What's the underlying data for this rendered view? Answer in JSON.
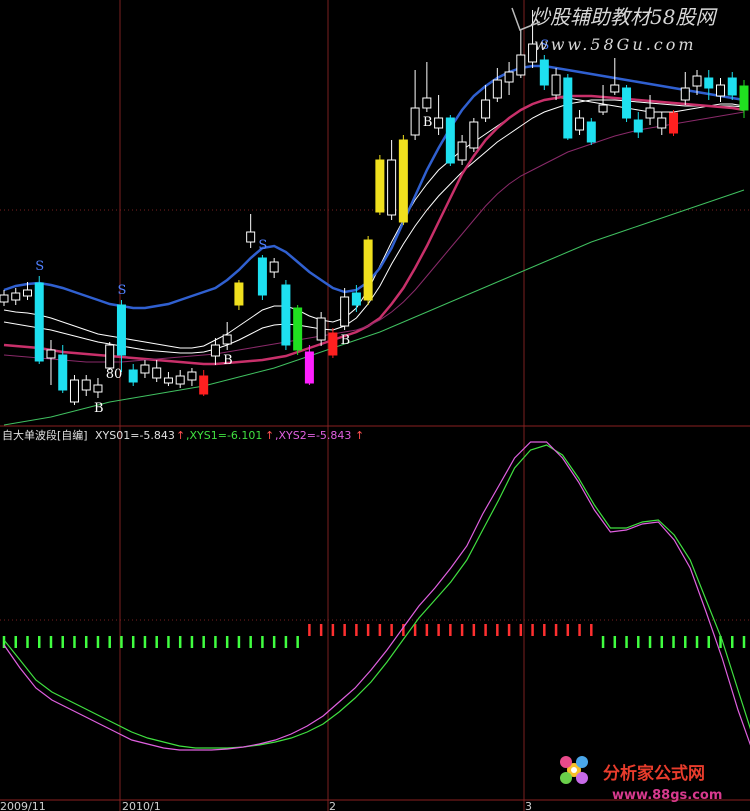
{
  "watermark_top": {
    "line1": "炒股辅助教材58股网",
    "line2": "www.58Gu.com"
  },
  "indicator_header": {
    "name": "自大单波段[自编]",
    "xys01": "XYS01=-5.843",
    "xys1": ",XYS1=-6.101",
    "xys2": ",XYS2=-5.843",
    "arrow": "↑"
  },
  "watermark_bottom": {
    "line1": "分析家公式网",
    "line2": "www.88gs.com"
  },
  "colors": {
    "background": "#000000",
    "grid": "#7a1f1f",
    "candle_cyan": "#1ee0f0",
    "candle_yellow": "#f0e01e",
    "candle_red": "#ff2020",
    "candle_green": "#20e020",
    "candle_magenta": "#ff20ff",
    "signal_red": "#ff3030",
    "signal_green": "#40ff40",
    "xys1_line": "#40e040",
    "xys2_line": "#e060e0"
  },
  "chart_data": [
    {
      "type": "candlestick",
      "title": "",
      "x_ticks": [
        "2009/11",
        "2010/1",
        "2",
        "3"
      ],
      "annotations": [
        {
          "text": "S",
          "bar": 3
        },
        {
          "text": "S",
          "bar": 10
        },
        {
          "text": "S",
          "bar": 22
        },
        {
          "text": "S",
          "bar": 46
        },
        {
          "text": "B",
          "bar": 8
        },
        {
          "text": "B",
          "bar": 19
        },
        {
          "text": "B",
          "bar": 29
        },
        {
          "text": "B",
          "bar": 36
        },
        {
          "text": "80",
          "bar": 9
        }
      ],
      "candles": [
        {
          "o": 295,
          "c": 302,
          "h": 290,
          "l": 306,
          "color": "white"
        },
        {
          "o": 300,
          "c": 293,
          "h": 288,
          "l": 305,
          "color": "white"
        },
        {
          "o": 290,
          "c": 296,
          "h": 282,
          "l": 300,
          "color": "white"
        },
        {
          "o": 283,
          "c": 361,
          "h": 276,
          "l": 364,
          "color": "cyan"
        },
        {
          "o": 350,
          "c": 358,
          "h": 340,
          "l": 385,
          "color": "white"
        },
        {
          "o": 355,
          "c": 390,
          "h": 345,
          "l": 393,
          "color": "cyan"
        },
        {
          "o": 380,
          "c": 402,
          "h": 375,
          "l": 405,
          "color": "white"
        },
        {
          "o": 390,
          "c": 380,
          "h": 375,
          "l": 396,
          "color": "white"
        },
        {
          "o": 385,
          "c": 392,
          "h": 378,
          "l": 398,
          "color": "white"
        },
        {
          "o": 345,
          "c": 368,
          "h": 342,
          "l": 370,
          "color": "white"
        },
        {
          "o": 305,
          "c": 355,
          "h": 300,
          "l": 372,
          "color": "cyan"
        },
        {
          "o": 370,
          "c": 382,
          "h": 364,
          "l": 386,
          "color": "cyan"
        },
        {
          "o": 373,
          "c": 365,
          "h": 360,
          "l": 378,
          "color": "white"
        },
        {
          "o": 368,
          "c": 378,
          "h": 360,
          "l": 382,
          "color": "white"
        },
        {
          "o": 378,
          "c": 383,
          "h": 372,
          "l": 386,
          "color": "white"
        },
        {
          "o": 376,
          "c": 384,
          "h": 370,
          "l": 388,
          "color": "white"
        },
        {
          "o": 372,
          "c": 380,
          "h": 368,
          "l": 386,
          "color": "white"
        },
        {
          "o": 376,
          "c": 394,
          "h": 370,
          "l": 396,
          "color": "red"
        },
        {
          "o": 345,
          "c": 356,
          "h": 338,
          "l": 365,
          "color": "white"
        },
        {
          "o": 335,
          "c": 344,
          "h": 322,
          "l": 350,
          "color": "white"
        },
        {
          "o": 283,
          "c": 305,
          "h": 280,
          "l": 310,
          "color": "yellow"
        },
        {
          "o": 232,
          "c": 242,
          "h": 214,
          "l": 248,
          "color": "white"
        },
        {
          "o": 258,
          "c": 295,
          "h": 255,
          "l": 300,
          "color": "cyan"
        },
        {
          "o": 262,
          "c": 272,
          "h": 258,
          "l": 278,
          "color": "white"
        },
        {
          "o": 285,
          "c": 345,
          "h": 280,
          "l": 350,
          "color": "cyan"
        },
        {
          "o": 308,
          "c": 350,
          "h": 305,
          "l": 355,
          "color": "green"
        },
        {
          "o": 352,
          "c": 383,
          "h": 345,
          "l": 385,
          "color": "magenta"
        },
        {
          "o": 318,
          "c": 340,
          "h": 312,
          "l": 346,
          "color": "white"
        },
        {
          "o": 355,
          "c": 333,
          "h": 328,
          "l": 358,
          "color": "red"
        },
        {
          "o": 297,
          "c": 326,
          "h": 288,
          "l": 330,
          "color": "white"
        },
        {
          "o": 293,
          "c": 305,
          "h": 285,
          "l": 312,
          "color": "cyan"
        },
        {
          "o": 240,
          "c": 300,
          "h": 236,
          "l": 305,
          "color": "yellow"
        },
        {
          "o": 160,
          "c": 212,
          "h": 155,
          "l": 215,
          "color": "yellow"
        },
        {
          "o": 160,
          "c": 215,
          "h": 140,
          "l": 220,
          "color": "white"
        },
        {
          "o": 140,
          "c": 222,
          "h": 135,
          "l": 225,
          "color": "yellow"
        },
        {
          "o": 108,
          "c": 135,
          "h": 70,
          "l": 140,
          "color": "white"
        },
        {
          "o": 98,
          "c": 108,
          "h": 62,
          "l": 112,
          "color": "white"
        },
        {
          "o": 118,
          "c": 128,
          "h": 95,
          "l": 135,
          "color": "white"
        },
        {
          "o": 118,
          "c": 163,
          "h": 115,
          "l": 166,
          "color": "cyan"
        },
        {
          "o": 142,
          "c": 160,
          "h": 135,
          "l": 165,
          "color": "white"
        },
        {
          "o": 122,
          "c": 148,
          "h": 118,
          "l": 152,
          "color": "white"
        },
        {
          "o": 100,
          "c": 118,
          "h": 85,
          "l": 122,
          "color": "white"
        },
        {
          "o": 80,
          "c": 98,
          "h": 68,
          "l": 102,
          "color": "white"
        },
        {
          "o": 72,
          "c": 82,
          "h": 62,
          "l": 95,
          "color": "white"
        },
        {
          "o": 55,
          "c": 75,
          "h": 30,
          "l": 78,
          "color": "white"
        },
        {
          "o": 44,
          "c": 62,
          "h": 10,
          "l": 68,
          "color": "white"
        },
        {
          "o": 60,
          "c": 85,
          "h": 55,
          "l": 90,
          "color": "cyan"
        },
        {
          "o": 75,
          "c": 95,
          "h": 68,
          "l": 100,
          "color": "white"
        },
        {
          "o": 78,
          "c": 138,
          "h": 74,
          "l": 140,
          "color": "cyan"
        },
        {
          "o": 118,
          "c": 130,
          "h": 110,
          "l": 135,
          "color": "white"
        },
        {
          "o": 122,
          "c": 142,
          "h": 118,
          "l": 145,
          "color": "cyan"
        },
        {
          "o": 105,
          "c": 112,
          "h": 85,
          "l": 115,
          "color": "white"
        },
        {
          "o": 85,
          "c": 92,
          "h": 58,
          "l": 95,
          "color": "white"
        },
        {
          "o": 88,
          "c": 118,
          "h": 85,
          "l": 122,
          "color": "cyan"
        },
        {
          "o": 120,
          "c": 132,
          "h": 112,
          "l": 138,
          "color": "cyan"
        },
        {
          "o": 108,
          "c": 118,
          "h": 95,
          "l": 125,
          "color": "white"
        },
        {
          "o": 118,
          "c": 128,
          "h": 112,
          "l": 135,
          "color": "white"
        },
        {
          "o": 113,
          "c": 133,
          "h": 110,
          "l": 136,
          "color": "red"
        },
        {
          "o": 88,
          "c": 100,
          "h": 72,
          "l": 105,
          "color": "white"
        },
        {
          "o": 76,
          "c": 86,
          "h": 70,
          "l": 95,
          "color": "white"
        },
        {
          "o": 78,
          "c": 88,
          "h": 70,
          "l": 100,
          "color": "cyan"
        },
        {
          "o": 85,
          "c": 96,
          "h": 78,
          "l": 102,
          "color": "white"
        },
        {
          "o": 78,
          "c": 95,
          "h": 72,
          "l": 100,
          "color": "cyan"
        },
        {
          "o": 86,
          "c": 110,
          "h": 80,
          "l": 118,
          "color": "green"
        }
      ],
      "moving_averages": [
        {
          "color": "#ffffff",
          "y": [
            310,
            312,
            313,
            315,
            318,
            322,
            326,
            330,
            334,
            336,
            338,
            340,
            342,
            344,
            346,
            348,
            348,
            346,
            340,
            334,
            326,
            318,
            310,
            306,
            306,
            310,
            316,
            320,
            322,
            318,
            308,
            290,
            266,
            242,
            220,
            200,
            184,
            170,
            160,
            150,
            142,
            134,
            126,
            118,
            110,
            104,
            100,
            98,
            98,
            100,
            102,
            104,
            106,
            108,
            110,
            112,
            112,
            112,
            110,
            108,
            106,
            104,
            104,
            106
          ]
        },
        {
          "color": "#ffffff",
          "y": [
            322,
            324,
            326,
            328,
            330,
            333,
            336,
            339,
            342,
            344,
            346,
            348,
            350,
            351,
            352,
            353,
            353,
            352,
            349,
            345,
            340,
            334,
            328,
            325,
            324,
            325,
            327,
            329,
            330,
            326,
            318,
            304,
            286,
            264,
            244,
            226,
            210,
            196,
            184,
            172,
            162,
            152,
            142,
            134,
            126,
            118,
            112,
            108,
            104,
            102,
            100,
            100,
            100,
            101,
            102,
            103,
            104,
            105,
            106,
            106,
            106,
            106,
            106,
            107
          ]
        },
        {
          "color": "#c8306a",
          "y": [
            345,
            346,
            347,
            348,
            350,
            352,
            353,
            354,
            355,
            356,
            357,
            358,
            359,
            360,
            361,
            362,
            363,
            364,
            364,
            363,
            362,
            361,
            360,
            358,
            356,
            352,
            348,
            344,
            340,
            336,
            332,
            326,
            318,
            304,
            288,
            268,
            246,
            222,
            198,
            174,
            156,
            140,
            128,
            118,
            110,
            104,
            100,
            98,
            96,
            96,
            96,
            97,
            98,
            99,
            100,
            101,
            102,
            103,
            104,
            105,
            106,
            107,
            108,
            110
          ]
        },
        {
          "color": "#8a2a6a",
          "y": [
            355,
            356,
            357,
            358,
            359,
            360,
            361,
            362,
            362,
            362,
            362,
            361,
            360,
            359,
            358,
            357,
            356,
            355,
            354,
            352,
            350,
            348,
            346,
            344,
            342,
            340,
            338,
            336,
            334,
            332,
            330,
            326,
            320,
            312,
            302,
            290,
            276,
            262,
            248,
            234,
            220,
            206,
            194,
            184,
            176,
            170,
            164,
            158,
            152,
            148,
            144,
            140,
            136,
            133,
            130,
            128,
            126,
            124,
            122,
            120,
            118,
            116,
            114,
            112
          ]
        },
        {
          "color": "#40c060",
          "y": [
            425,
            423,
            421,
            419,
            417,
            414,
            411,
            408,
            405,
            402,
            400,
            398,
            396,
            394,
            392,
            390,
            388,
            386,
            383,
            380,
            377,
            374,
            371,
            368,
            364,
            360,
            356,
            352,
            348,
            344,
            340,
            336,
            332,
            327,
            322,
            317,
            312,
            307,
            302,
            297,
            292,
            287,
            282,
            277,
            272,
            267,
            262,
            257,
            252,
            247,
            242,
            238,
            234,
            230,
            226,
            222,
            218,
            214,
            210,
            206,
            202,
            198,
            194,
            190
          ]
        },
        {
          "color": "#3060d0",
          "y": [
            290,
            286,
            284,
            283,
            285,
            288,
            292,
            296,
            300,
            304,
            306,
            308,
            308,
            306,
            304,
            300,
            296,
            292,
            288,
            280,
            270,
            258,
            248,
            246,
            252,
            262,
            272,
            280,
            288,
            292,
            290,
            282,
            268,
            248,
            222,
            196,
            170,
            148,
            128,
            110,
            96,
            86,
            78,
            72,
            68,
            66,
            66,
            68,
            70,
            72,
            74,
            76,
            78,
            80,
            82,
            84,
            86,
            88,
            90,
            92,
            94,
            96,
            98,
            100
          ]
        }
      ]
    },
    {
      "type": "line",
      "title": "自大单波段[自编]",
      "x_ticks": [
        "2009/11",
        "2010/1",
        "2",
        "3"
      ],
      "series": [
        {
          "name": "XYS1",
          "color": "#40e040",
          "y": [
            640,
            660,
            680,
            692,
            700,
            708,
            716,
            724,
            732,
            738,
            742,
            746,
            748,
            748,
            748,
            747,
            745,
            742,
            738,
            732,
            724,
            712,
            698,
            682,
            662,
            640,
            618,
            600,
            582,
            560,
            530,
            500,
            468,
            450,
            445,
            455,
            478,
            505,
            528,
            528,
            522,
            520,
            535,
            560,
            600,
            640,
            690,
            740
          ]
        },
        {
          "name": "XYS2",
          "color": "#e060e0",
          "y": [
            645,
            668,
            688,
            700,
            708,
            716,
            724,
            732,
            740,
            744,
            748,
            750,
            750,
            750,
            749,
            747,
            744,
            740,
            734,
            726,
            716,
            702,
            688,
            670,
            650,
            628,
            606,
            588,
            568,
            546,
            514,
            486,
            458,
            442,
            442,
            458,
            482,
            510,
            532,
            530,
            524,
            522,
            540,
            568,
            612,
            658,
            710,
            755
          ]
        }
      ],
      "signal_bars": {
        "red_from": 26,
        "red_to": 50,
        "count": 64
      }
    }
  ]
}
